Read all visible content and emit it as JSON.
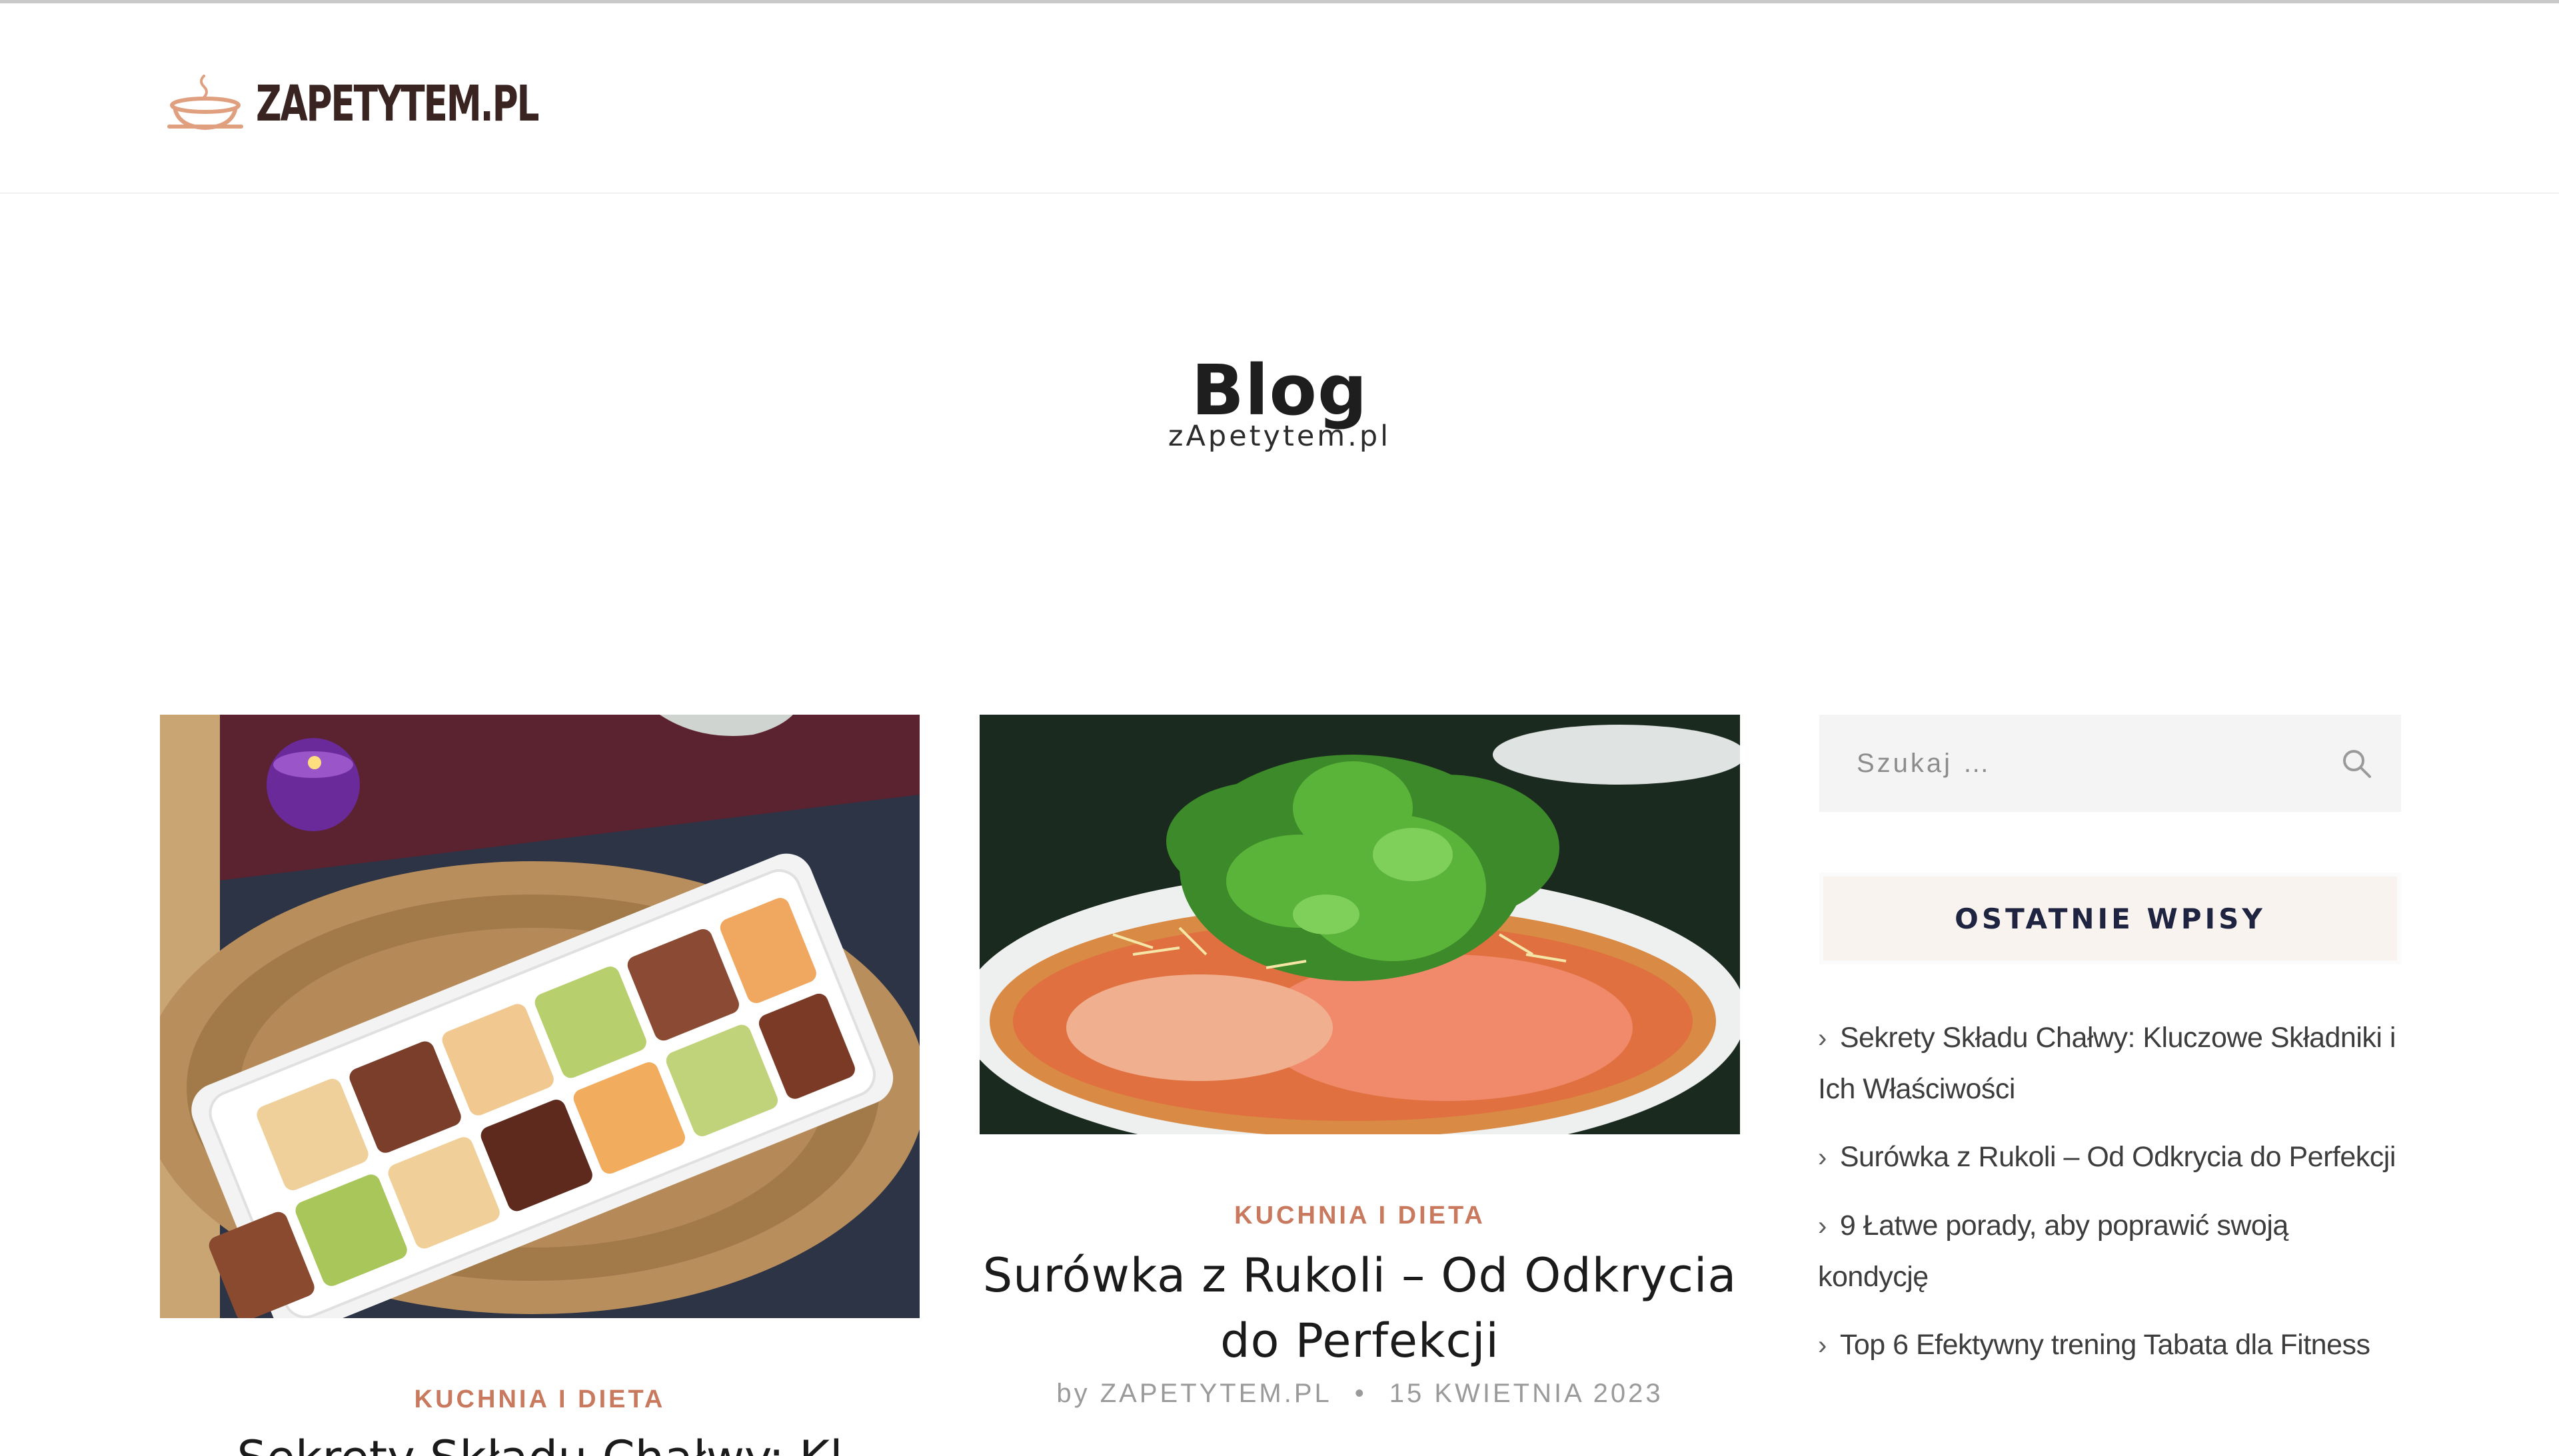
{
  "site": {
    "logo_text": "ZAPETYTEM.PL"
  },
  "page": {
    "title": "Blog",
    "subtitle": "zApetytem.pl"
  },
  "posts": [
    {
      "category": "KUCHNIA I DIETA",
      "title": "Sekrety Składu Chałwy: Kl"
    },
    {
      "category": "KUCHNIA I DIETA",
      "title_line1": "Surówka z Rukoli – Od Odkrycia",
      "title_line2": "do Perfekcji",
      "author": "by ZAPETYTEM.PL",
      "date": "15 KWIETNIA 2023"
    }
  ],
  "sidebar": {
    "search": {
      "placeholder": "Szukaj …"
    },
    "recent": {
      "title": "OSTATNIE WPISY",
      "items": [
        "Sekrety Składu Chałwy: Kluczowe Składniki i Ich Właściwości",
        "Surówka z Rukoli – Od Odkrycia do Perfekcji",
        "9 Łatwe porady, aby poprawić swoją kondycję",
        "Top 6 Efektywny trening Tabata dla Fitness"
      ]
    }
  },
  "colors": {
    "accent": "#c97a5e",
    "logo": "#3a2421",
    "widget_title": "#1f2440"
  },
  "icons": {
    "search": "search-icon",
    "logo": "pot-logo-icon",
    "chevron": "chevron-right-icon"
  }
}
